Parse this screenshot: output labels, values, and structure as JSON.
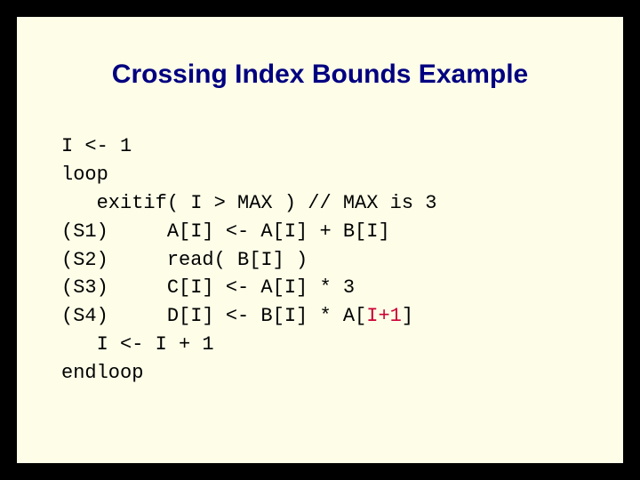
{
  "title": "Crossing Index Bounds Example",
  "code": {
    "l1": "I <- 1",
    "l2": "loop",
    "l3": "   exitif( I > MAX ) // MAX is 3",
    "l4": "(S1)     A[I] <- A[I] + B[I]",
    "l5": "(S2)     read( B[I] )",
    "l6": "(S3)     C[I] <- A[I] * 3",
    "l7a": "(S4)     D[I] <- B[I] * A[",
    "l7b": "I+1",
    "l7c": "]",
    "l8": "   I <- I + 1",
    "l9": "endloop"
  }
}
